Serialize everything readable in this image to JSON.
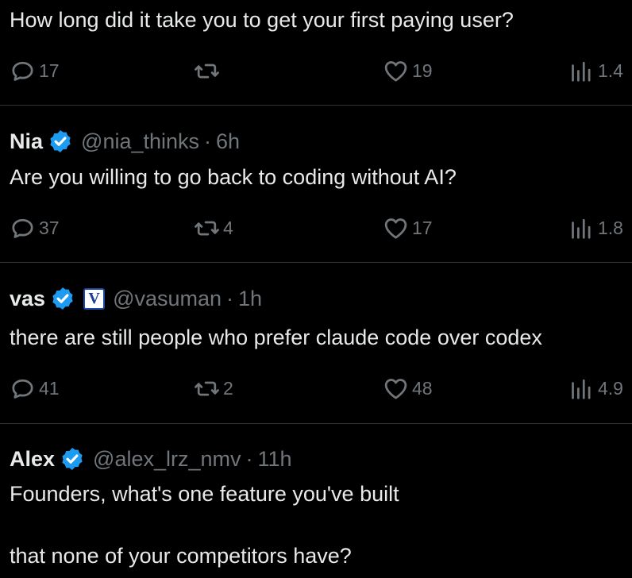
{
  "posts": [
    {
      "text": "How long did it take you to get your first paying user?",
      "replies": "17",
      "reposts": "",
      "likes": "19",
      "views": "1.4"
    },
    {
      "name": "Nia",
      "handle": "@nia_thinks",
      "time": "6h",
      "text": "Are you willing to go back to coding without AI?",
      "replies": "37",
      "reposts": "4",
      "likes": "17",
      "views": "1.8"
    },
    {
      "name": "vas",
      "affiliate_badge": "V",
      "handle": "@vasuman",
      "time": "1h",
      "text": "there are still people who prefer claude code over codex",
      "replies": "41",
      "reposts": "2",
      "likes": "48",
      "views": "4.9"
    },
    {
      "name": "Alex",
      "handle": "@alex_lrz_nmv",
      "time": "11h",
      "text_line1": "Founders, what's one feature you've built",
      "text_line2": "that none of your competitors have?"
    }
  ],
  "separator": "·",
  "colors": {
    "background": "#000000",
    "text": "#e7e9ea",
    "muted": "#71767b",
    "verified": "#1d9bf0",
    "divider": "#2f3336"
  },
  "icons": [
    "reply-icon",
    "repost-icon",
    "like-icon",
    "views-icon",
    "verified-badge-icon"
  ]
}
